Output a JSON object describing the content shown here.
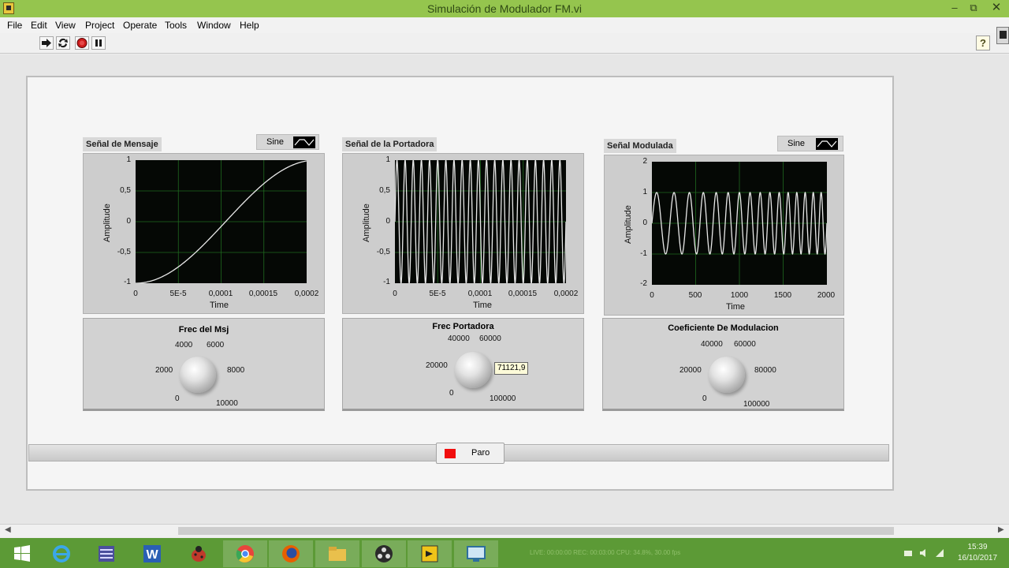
{
  "window": {
    "title": "Simulación de Modulador FM.vi",
    "controls": {
      "minimize": "–",
      "restore": "⧉",
      "close": "✕"
    }
  },
  "menu": [
    "File",
    "Edit",
    "View",
    "Project",
    "Operate",
    "Tools",
    "Window",
    "Help"
  ],
  "toolbar": {
    "help": "?"
  },
  "graphs": {
    "mensaje": {
      "label": "Señal de Mensaje",
      "legend": "Sine",
      "y_label": "Amplitude",
      "x_label": "Time",
      "y_ticks": [
        "1",
        "0,5",
        "0",
        "-0,5",
        "-1"
      ],
      "x_ticks": [
        "0",
        "5E-5",
        "0,0001",
        "0,00015",
        "0,0002"
      ]
    },
    "portadora": {
      "label": "Señal de la Portadora",
      "y_label": "Amplitude",
      "x_label": "Time",
      "y_ticks": [
        "1",
        "0,5",
        "0",
        "-0,5",
        "-1"
      ],
      "x_ticks": [
        "0",
        "5E-5",
        "0,0001",
        "0,00015",
        "0,0002"
      ]
    },
    "modulada": {
      "label": "Señal Modulada",
      "legend": "Sine",
      "y_label": "Amplitude",
      "x_label": "Time",
      "y_ticks": [
        "2",
        "1",
        "0",
        "-1",
        "-2"
      ],
      "x_ticks": [
        "0",
        "500",
        "1000",
        "1500",
        "2000"
      ]
    }
  },
  "chart_data": [
    {
      "type": "line",
      "y_range": [
        -1,
        1
      ],
      "x_range": [
        0,
        0.0002
      ],
      "series": [
        {
          "name": "Sine",
          "shape": "quarter-period sine from -1 rising to 1"
        }
      ]
    },
    {
      "type": "line",
      "y_range": [
        -1,
        1
      ],
      "x_range": [
        0,
        0.0002
      ],
      "series": [
        {
          "shape": "high-frequency sine, about 20 cycles, amplitude 1"
        }
      ]
    },
    {
      "type": "line",
      "y_range": [
        -2,
        2
      ],
      "x_range": [
        0,
        2000
      ],
      "series": [
        {
          "name": "Sine",
          "shape": "FM sine, amplitude 1, frequency increasing left to right"
        }
      ]
    }
  ],
  "knobs": {
    "msj": {
      "title": "Frec del Msj",
      "scale": [
        "4000",
        "6000",
        "2000",
        "8000",
        "0",
        "10000"
      ]
    },
    "portadora": {
      "title": "Frec Portadora",
      "scale": [
        "40000",
        "60000",
        "20000",
        "0",
        "100000"
      ],
      "value_tip": "71121,9"
    },
    "coef": {
      "title": "Coeficiente De Modulacion",
      "scale": [
        "40000",
        "60000",
        "20000",
        "80000",
        "0",
        "100000"
      ]
    }
  },
  "stop": {
    "label": "Paro",
    "led_color": "#f10e0e"
  },
  "taskbar": {
    "apps": [
      "windows-start",
      "internet-explorer",
      "server-manager",
      "word",
      "ladybug",
      "chrome",
      "firefox",
      "file-explorer",
      "obs",
      "labview",
      "remote-desktop"
    ],
    "status": "LIVE: 00:00:00     REC: 00:03:00     CPU: 34.8%, 30.00 fps",
    "time": "15:39",
    "date": "16/10/2017"
  },
  "colors": {
    "titlebar": "#95c54e",
    "taskbar": "#5c9a36",
    "plot_bg": "#050805",
    "grid": "#1f6a1f",
    "trace": "#e8e8e8"
  }
}
